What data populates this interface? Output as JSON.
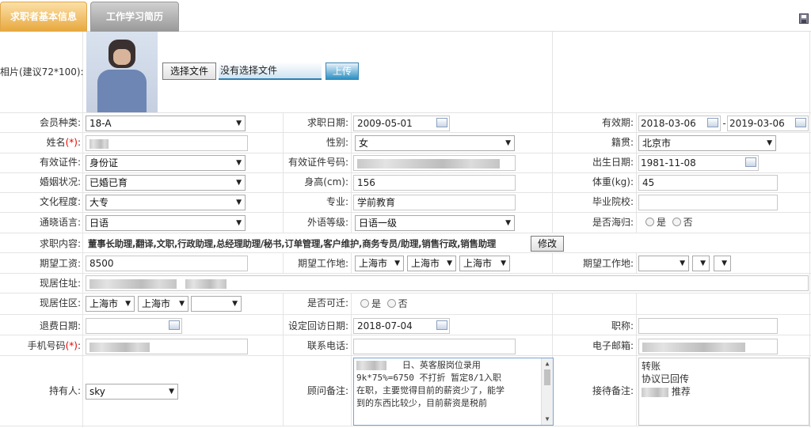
{
  "tabs": [
    {
      "label": "求职者基本信息"
    },
    {
      "label": "工作学习简历"
    }
  ],
  "photo": {
    "label": "相片(建议72*100):",
    "choose_file": "选择文件",
    "no_file": "没有选择文件",
    "upload": "上传"
  },
  "member_type": {
    "label": "会员种类:",
    "value": "18-A"
  },
  "apply_date": {
    "label": "求职日期:",
    "value": "2009-05-01"
  },
  "valid_period": {
    "label": "有效期:",
    "start": "2018-03-06",
    "sep": "-",
    "end": "2019-03-06"
  },
  "name": {
    "label": "姓名",
    "req": "(*)",
    "colon": ":"
  },
  "gender": {
    "label": "性别:",
    "value": "女"
  },
  "native_place": {
    "label": "籍贯:",
    "value": "北京市"
  },
  "id_type": {
    "label": "有效证件:",
    "value": "身份证"
  },
  "id_number": {
    "label": "有效证件号码:"
  },
  "birth_date": {
    "label": "出生日期:",
    "value": "1981-11-08"
  },
  "marital": {
    "label": "婚姻状况:",
    "value": "已婚已育"
  },
  "height": {
    "label": "身高(cm):",
    "value": "156"
  },
  "weight": {
    "label": "体重(kg):",
    "value": "45"
  },
  "education": {
    "label": "文化程度:",
    "value": "大专"
  },
  "major": {
    "label": "专业:",
    "value": "学前教育"
  },
  "school": {
    "label": "毕业院校:",
    "value": ""
  },
  "language": {
    "label": "通晓语言:",
    "value": "日语"
  },
  "foreign_level": {
    "label": "外语等级:",
    "value": "日语一级"
  },
  "overseas": {
    "label": "是否海归:",
    "yes": "是",
    "no": "否"
  },
  "job_content": {
    "label": "求职内容:",
    "value": "董事长助理,翻译,文职,行政助理,总经理助理/秘书,订单管理,客户维护,商务专员/助理,销售行政,销售助理",
    "modify": "修改"
  },
  "expected_salary": {
    "label": "期望工资:",
    "value": "8500"
  },
  "work_place1": {
    "label": "期望工作地:",
    "v1": "上海市",
    "v2": "上海市",
    "v3": "上海市"
  },
  "work_place2": {
    "label": "期望工作地:"
  },
  "address": {
    "label": "现居住址:"
  },
  "district": {
    "label": "现居住区:",
    "v1": "上海市",
    "v2": "上海市"
  },
  "relocate": {
    "label": "是否可迁:",
    "yes": "是",
    "no": "否"
  },
  "refund_date": {
    "label": "退费日期:"
  },
  "visit_date": {
    "label": "设定回访日期:",
    "value": "2018-07-04"
  },
  "title": {
    "label": "职称:"
  },
  "mobile": {
    "label": "手机号码",
    "req": "(*)",
    "colon": ":"
  },
  "phone": {
    "label": "联系电话:"
  },
  "email": {
    "label": "电子邮箱:"
  },
  "holder": {
    "label": "持有人:",
    "value": "sky"
  },
  "advisor_note": {
    "label": "顾问备注:",
    "line1": "日、英客服岗位录用",
    "line2": "9k*75%=6750 不打折 暂定8/1入职",
    "line3": "在职，主要觉得目前的薪资少了，能学",
    "line4": "到的东西比较少，目前薪资是税前"
  },
  "reception_note": {
    "label": "接待备注:",
    "line1": "转账",
    "line2": "协议已回传",
    "line3": "推荐"
  }
}
